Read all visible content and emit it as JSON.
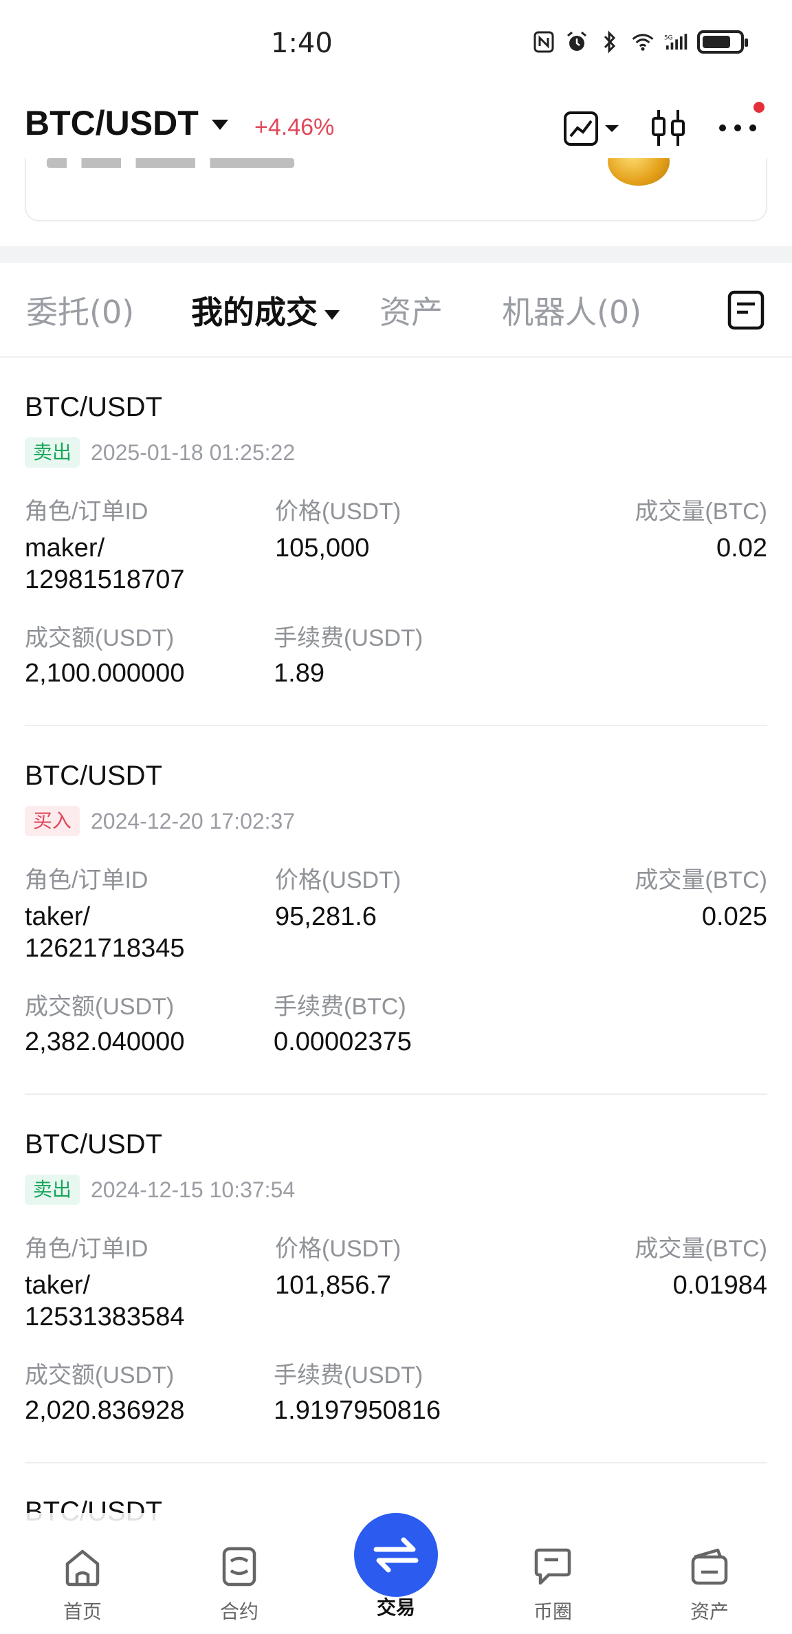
{
  "status_bar": {
    "time": "1:40"
  },
  "header": {
    "pair": "BTC/USDT",
    "change": "+4.46%"
  },
  "tabs": [
    {
      "label": "委托(0)"
    },
    {
      "label": "我的成交"
    },
    {
      "label": "资产"
    },
    {
      "label": "机器人(0)"
    }
  ],
  "trades": [
    {
      "pair": "BTC/USDT",
      "side": "卖出",
      "time": "2025-01-18 01:25:22",
      "role_label": "角色/订单ID",
      "role": "maker/",
      "order_id": "12981518707",
      "price_label": "价格(USDT)",
      "price": "105,000",
      "qty_label": "成交量(BTC)",
      "qty": "0.02",
      "amount_label": "成交额(USDT)",
      "amount": "2,100.000000",
      "fee_label": "手续费(USDT)",
      "fee": "1.89"
    },
    {
      "pair": "BTC/USDT",
      "side": "买入",
      "time": "2024-12-20 17:02:37",
      "role_label": "角色/订单ID",
      "role": "taker/",
      "order_id": "12621718345",
      "price_label": "价格(USDT)",
      "price": "95,281.6",
      "qty_label": "成交量(BTC)",
      "qty": "0.025",
      "amount_label": "成交额(USDT)",
      "amount": "2,382.040000",
      "fee_label": "手续费(BTC)",
      "fee": "0.00002375"
    },
    {
      "pair": "BTC/USDT",
      "side": "卖出",
      "time": "2024-12-15 10:37:54",
      "role_label": "角色/订单ID",
      "role": "taker/",
      "order_id": "12531383584",
      "price_label": "价格(USDT)",
      "price": "101,856.7",
      "qty_label": "成交量(BTC)",
      "qty": "0.01984",
      "amount_label": "成交额(USDT)",
      "amount": "2,020.836928",
      "fee_label": "手续费(USDT)",
      "fee": "1.9197950816"
    }
  ],
  "partial_next_pair": "BTC/USDT",
  "bottom_nav": [
    {
      "label": "首页",
      "icon": "home-icon"
    },
    {
      "label": "合约",
      "icon": "contract-icon"
    },
    {
      "label": "交易",
      "icon": "swap-icon"
    },
    {
      "label": "币圈",
      "icon": "chat-icon"
    },
    {
      "label": "资产",
      "icon": "wallet-icon"
    }
  ],
  "colors": {
    "up": "#e0485a",
    "sell": "#17a55b",
    "buy": "#e0485a",
    "accent": "#2c5bf0"
  }
}
